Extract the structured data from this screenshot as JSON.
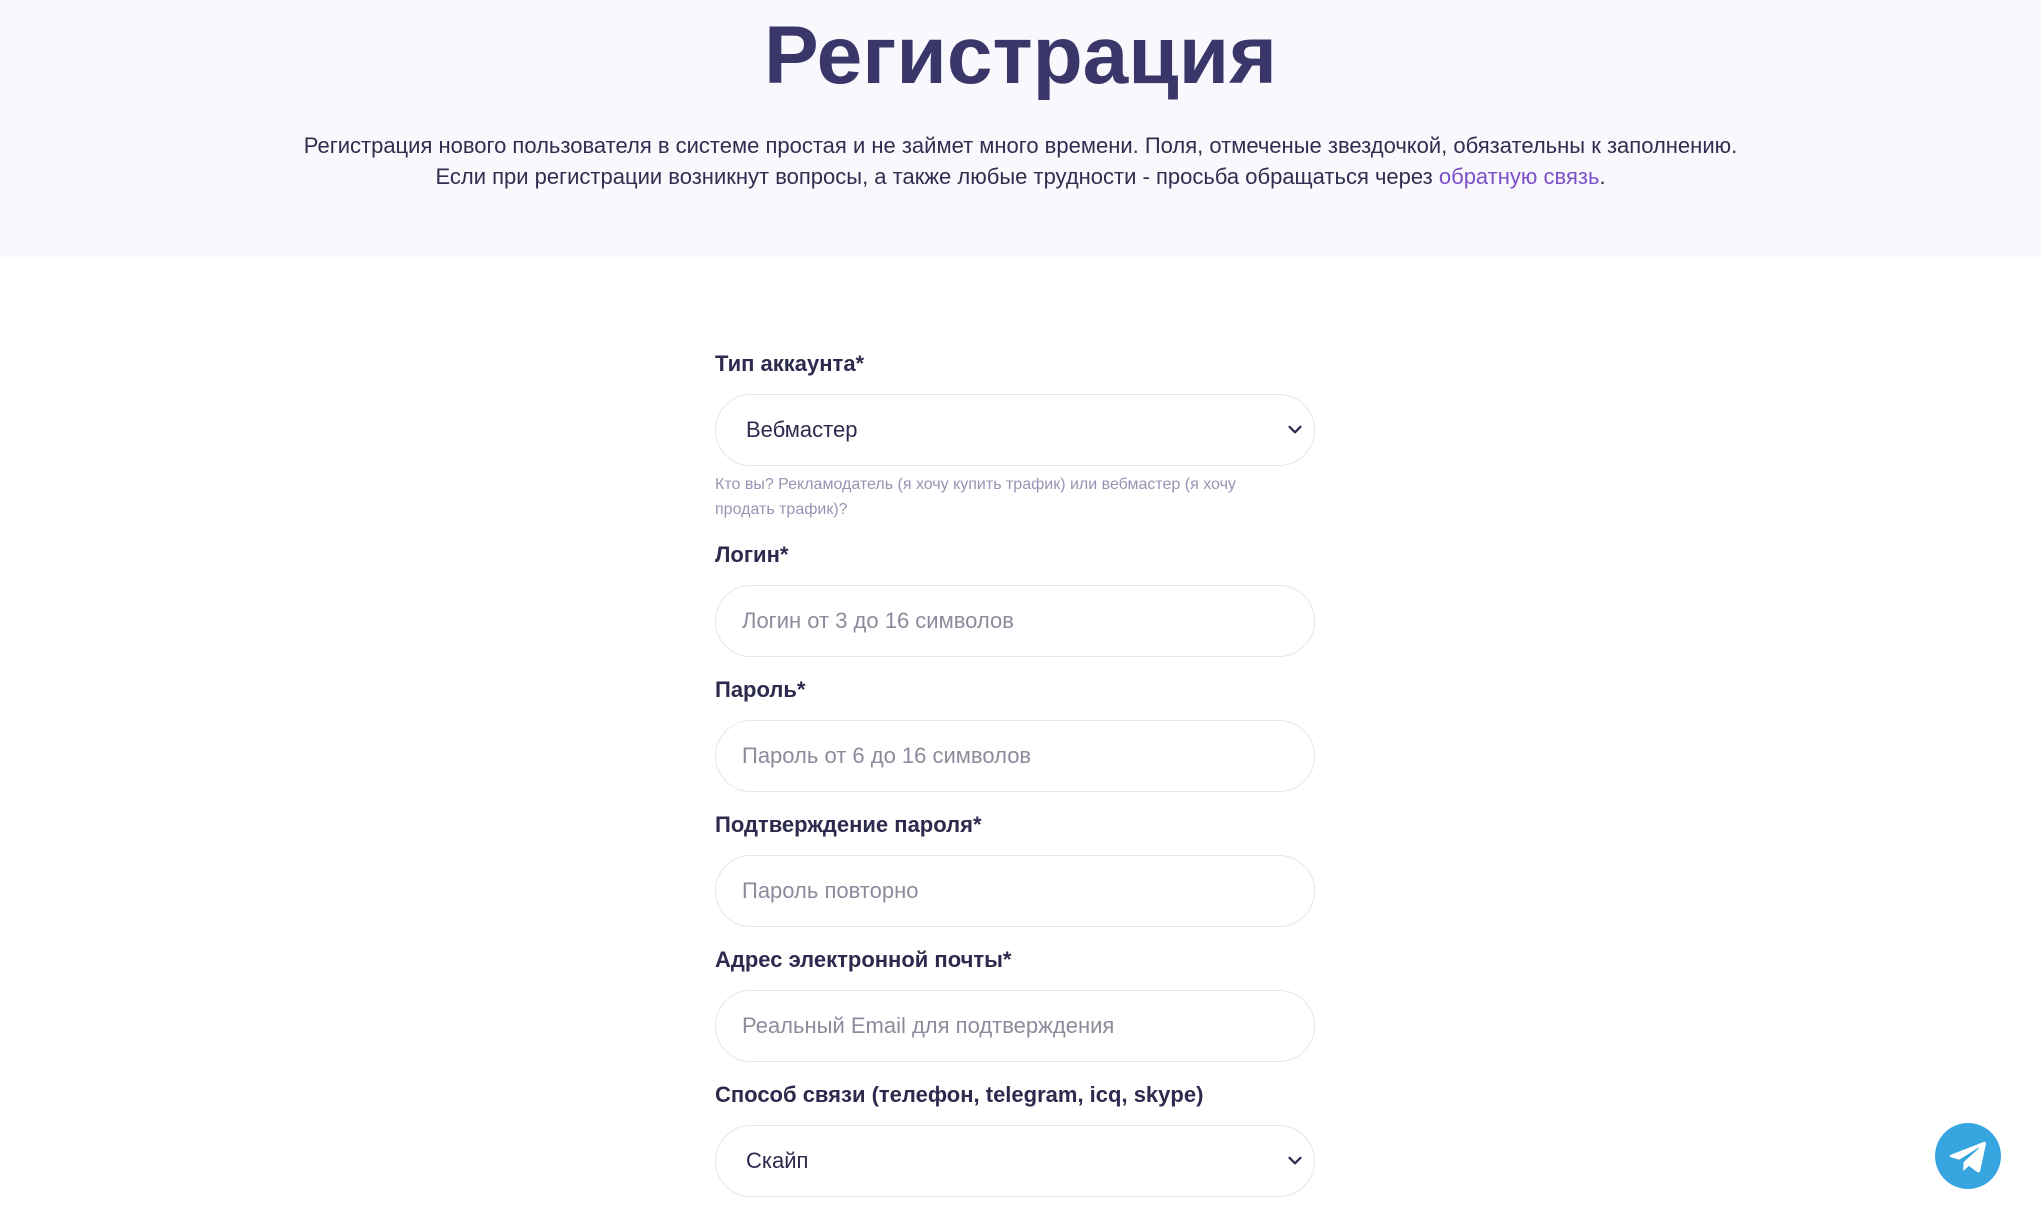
{
  "hero": {
    "title": "Регистрация",
    "desc_line1": "Регистрация нового пользователя в системе простая и не займет много времени. Поля, отмеченые звездочкой, обязательны к заполнению.",
    "desc_line2_prefix": "Если при регистрации возникнут вопросы, а также любые трудности - просьба обращаться через ",
    "desc_link": "обратную связь",
    "desc_line2_suffix": "."
  },
  "form": {
    "account_type": {
      "label": "Тип аккаунта*",
      "value": "Вебмастер",
      "hint": "Кто вы? Рекламодатель (я хочу купить трафик) или вебмастер (я хочу продать трафик)?"
    },
    "login": {
      "label": "Логин*",
      "placeholder": "Логин от 3 до 16 символов"
    },
    "password": {
      "label": "Пароль*",
      "placeholder": "Пароль от 6 до 16 символов"
    },
    "password_confirm": {
      "label": "Подтверждение пароля*",
      "placeholder": "Пароль повторно"
    },
    "email": {
      "label": "Адрес электронной почты*",
      "placeholder": "Реальный Email для подтверждения"
    },
    "contact_method": {
      "label": "Способ связи (телефон, telegram, icq, skype)",
      "value": "Скайп"
    }
  },
  "colors": {
    "hero_bg": "#f8f8fd",
    "title": "#3b3669",
    "link": "#7c4fc9",
    "hint": "#9893b5",
    "telegram": "#37a5e0"
  },
  "icons": {
    "select_arrow": "chevron-down-icon",
    "floating": "telegram-icon"
  }
}
